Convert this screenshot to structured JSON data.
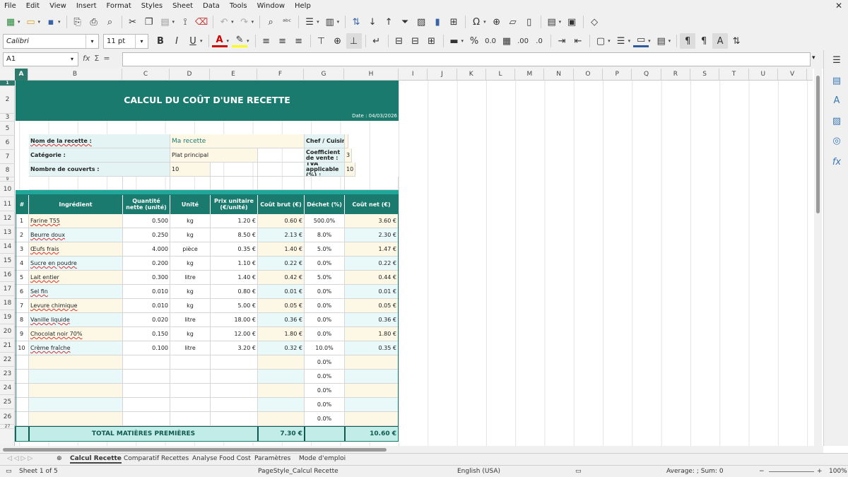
{
  "menu": [
    "File",
    "Edit",
    "View",
    "Insert",
    "Format",
    "Styles",
    "Sheet",
    "Data",
    "Tools",
    "Window",
    "Help"
  ],
  "toolbar": {
    "font_name": "Calibri",
    "font_size": "11 pt",
    "bold": "B",
    "italic": "I",
    "underline": "U"
  },
  "formula_bar": {
    "cell_ref": "A1",
    "fx": "fx",
    "sum": "Σ",
    "eq": "=",
    "content": ""
  },
  "columns": [
    "A",
    "B",
    "C",
    "D",
    "E",
    "F",
    "G",
    "H",
    "I",
    "J",
    "K",
    "L",
    "M",
    "N",
    "O",
    "P",
    "Q",
    "R",
    "S",
    "T",
    "U",
    "V"
  ],
  "rows": [
    "1",
    "2",
    "3",
    "5",
    "6",
    "7",
    "8",
    "9",
    "10",
    "11",
    "12",
    "13",
    "14",
    "15",
    "16",
    "17",
    "18",
    "19",
    "20",
    "21",
    "22",
    "23",
    "24",
    "25",
    "26",
    "27"
  ],
  "sheet": {
    "title": "CALCUL DU COÛT D'UNE RECETTE",
    "date": "Date : 04/03/2026",
    "recipe_label": "Nom de la recette :",
    "recipe_value": "Ma recette",
    "chef_label": "Chef / Cuisinier :",
    "category_label": "Catégorie :",
    "category_value": "Plat principal",
    "coef_label": "Coefficient de vente :",
    "coef_value": "3",
    "covers_label": "Nombre de couverts :",
    "covers_value": "10",
    "tva_label": "TVA applicable (%) :",
    "tva_value": "10",
    "headers": [
      "#",
      "Ingrédient",
      "Quantité nette (unité)",
      "Unité",
      "Prix unitaire (€/unité)",
      "Coût brut (€)",
      "Déchet (%)",
      "Coût net (€)"
    ],
    "items": [
      [
        "1",
        "Farine T55",
        "0.500",
        "kg",
        "1.20 €",
        "0.60 €",
        "500.0%",
        "3.60 €"
      ],
      [
        "2",
        "Beurre doux",
        "0.250",
        "kg",
        "8.50 €",
        "2.13 €",
        "8.0%",
        "2.30 €"
      ],
      [
        "3",
        "Œufs frais",
        "4.000",
        "pièce",
        "0.35 €",
        "1.40 €",
        "5.0%",
        "1.47 €"
      ],
      [
        "4",
        "Sucre en poudre",
        "0.200",
        "kg",
        "1.10 €",
        "0.22 €",
        "0.0%",
        "0.22 €"
      ],
      [
        "5",
        "Lait entier",
        "0.300",
        "litre",
        "1.40 €",
        "0.42 €",
        "5.0%",
        "0.44 €"
      ],
      [
        "6",
        "Sel fin",
        "0.010",
        "kg",
        "0.80 €",
        "0.01 €",
        "0.0%",
        "0.01 €"
      ],
      [
        "7",
        "Levure chimique",
        "0.010",
        "kg",
        "5.00 €",
        "0.05 €",
        "0.0%",
        "0.05 €"
      ],
      [
        "8",
        "Vanille liquide",
        "0.020",
        "litre",
        "18.00 €",
        "0.36 €",
        "0.0%",
        "0.36 €"
      ],
      [
        "9",
        "Chocolat noir 70%",
        "0.150",
        "kg",
        "12.00 €",
        "1.80 €",
        "0.0%",
        "1.80 €"
      ],
      [
        "10",
        "Crème fraîche",
        "0.100",
        "litre",
        "3.20 €",
        "0.32 €",
        "10.0%",
        "0.35 €"
      ]
    ],
    "empty_waste": "0.0%",
    "total_label": "TOTAL MATIÈRES PREMIÈRES",
    "total_brut": "7.30 €",
    "total_net": "10.60 €"
  },
  "tabs": [
    "Calcul Recette",
    "Comparatif Recettes",
    "Analyse Food Cost",
    "Paramètres",
    "Mode d'emploi"
  ],
  "status": {
    "sheet": "Sheet 1 of 5",
    "page_style": "PageStyle_Calcul Recette",
    "language": "English (USA)",
    "sum": "Average: ; Sum: 0",
    "zoom": "100%"
  }
}
